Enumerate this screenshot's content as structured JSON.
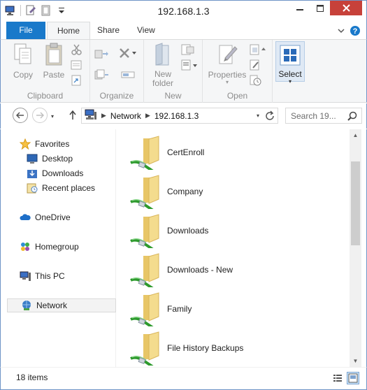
{
  "window": {
    "title": "192.168.1.3"
  },
  "ribbon_tabs": [
    {
      "label": "File"
    },
    {
      "label": "Home"
    },
    {
      "label": "Share"
    },
    {
      "label": "View"
    }
  ],
  "ribbon": {
    "clipboard": {
      "label": "Clipboard",
      "copy": "Copy",
      "paste": "Paste"
    },
    "organize": {
      "label": "Organize"
    },
    "new": {
      "label": "New",
      "new_folder": "New folder"
    },
    "open": {
      "label": "Open",
      "properties": "Properties"
    },
    "select": {
      "label": "Select"
    }
  },
  "address": {
    "breadcrumb": [
      "Network",
      "192.168.1.3"
    ],
    "search_placeholder": "Search 19..."
  },
  "nav": {
    "favorites": "Favorites",
    "desktop": "Desktop",
    "downloads": "Downloads",
    "recent": "Recent places",
    "onedrive": "OneDrive",
    "homegroup": "Homegroup",
    "thispc": "This PC",
    "network": "Network"
  },
  "items": [
    {
      "name": "CertEnroll"
    },
    {
      "name": "Company"
    },
    {
      "name": "Downloads"
    },
    {
      "name": "Downloads - New"
    },
    {
      "name": "Family"
    },
    {
      "name": "File History Backups"
    }
  ],
  "status": {
    "count": "18 items"
  },
  "colors": {
    "accent": "#1979ca",
    "close": "#c7413a",
    "folder": "#f2d57e",
    "share_pipe": "#3ca23c"
  }
}
